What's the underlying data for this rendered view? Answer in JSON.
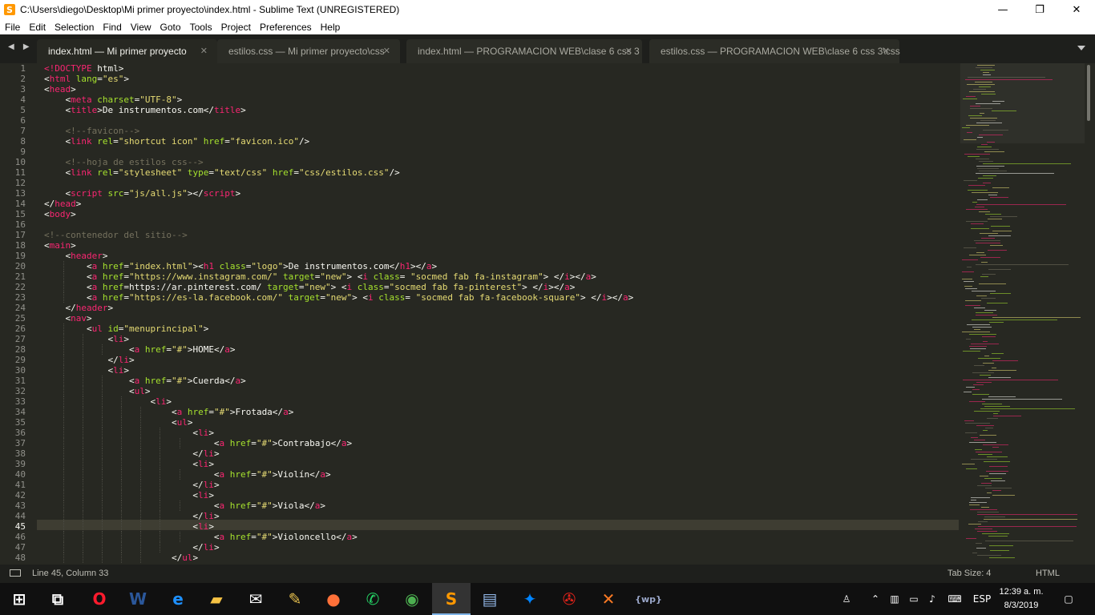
{
  "window": {
    "title": "C:\\Users\\diego\\Desktop\\Mi primer proyecto\\index.html - Sublime Text (UNREGISTERED)",
    "app_icon": "S",
    "controls": [
      "—",
      "❐",
      "✕"
    ]
  },
  "menu": [
    "File",
    "Edit",
    "Selection",
    "Find",
    "View",
    "Goto",
    "Tools",
    "Project",
    "Preferences",
    "Help"
  ],
  "tabs": [
    {
      "label": "index.html — Mi primer proyecto",
      "active": true
    },
    {
      "label": "estilos.css — Mi primer proyecto\\css",
      "active": false
    },
    {
      "label": "index.html — PROGRAMACION  WEB\\clase 6 css 3",
      "active": false
    },
    {
      "label": "estilos.css — PROGRAMACION  WEB\\clase 6 css 3\\css",
      "active": false
    }
  ],
  "tab_nav": "◀ ▶",
  "tab_close": "✕",
  "editor": {
    "current_line": 45,
    "line_numbers": [
      1,
      2,
      3,
      4,
      5,
      6,
      7,
      8,
      9,
      10,
      11,
      12,
      13,
      14,
      15,
      16,
      17,
      18,
      19,
      20,
      21,
      22,
      23,
      24,
      25,
      26,
      27,
      28,
      29,
      30,
      31,
      32,
      33,
      34,
      35,
      36,
      37,
      38,
      39,
      40,
      41,
      42,
      43,
      44,
      45,
      46,
      47,
      48
    ],
    "lines": [
      [
        [
          "t",
          "<!DOCTYPE"
        ],
        [
          "p",
          " html>"
        ]
      ],
      [
        [
          "p",
          "<"
        ],
        [
          "t",
          "html"
        ],
        [
          "a",
          " lang"
        ],
        [
          "p",
          "="
        ],
        [
          "s",
          "\"es\""
        ],
        [
          "p",
          ">"
        ]
      ],
      [
        [
          "p",
          "<"
        ],
        [
          "t",
          "head"
        ],
        [
          "p",
          ">"
        ]
      ],
      [
        [
          "p",
          "    <"
        ],
        [
          "t",
          "meta"
        ],
        [
          "a",
          " charset"
        ],
        [
          "p",
          "="
        ],
        [
          "s",
          "\"UTF-8\""
        ],
        [
          "p",
          ">"
        ]
      ],
      [
        [
          "p",
          "    <"
        ],
        [
          "t",
          "title"
        ],
        [
          "p",
          ">De instrumentos.com</"
        ],
        [
          "t",
          "title"
        ],
        [
          "p",
          ">"
        ]
      ],
      [
        [
          "p",
          ""
        ]
      ],
      [
        [
          "c",
          "    <!--favicon-->"
        ]
      ],
      [
        [
          "p",
          "    <"
        ],
        [
          "t",
          "link"
        ],
        [
          "a",
          " rel"
        ],
        [
          "p",
          "="
        ],
        [
          "s",
          "\"shortcut icon\""
        ],
        [
          "a",
          " href"
        ],
        [
          "p",
          "="
        ],
        [
          "s",
          "\"favicon.ico\""
        ],
        [
          "p",
          "/>"
        ]
      ],
      [
        [
          "p",
          ""
        ]
      ],
      [
        [
          "c",
          "    <!--hoja de estilos css-->"
        ]
      ],
      [
        [
          "p",
          "    <"
        ],
        [
          "t",
          "link"
        ],
        [
          "a",
          " rel"
        ],
        [
          "p",
          "="
        ],
        [
          "s",
          "\"stylesheet\""
        ],
        [
          "a",
          " type"
        ],
        [
          "p",
          "="
        ],
        [
          "s",
          "\"text/css\""
        ],
        [
          "a",
          " href"
        ],
        [
          "p",
          "="
        ],
        [
          "s",
          "\"css/estilos.css\""
        ],
        [
          "p",
          "/>"
        ]
      ],
      [
        [
          "p",
          ""
        ]
      ],
      [
        [
          "p",
          "    <"
        ],
        [
          "t",
          "script"
        ],
        [
          "a",
          " src"
        ],
        [
          "p",
          "="
        ],
        [
          "s",
          "\"js/all.js\""
        ],
        [
          "p",
          "></"
        ],
        [
          "t",
          "script"
        ],
        [
          "p",
          ">"
        ]
      ],
      [
        [
          "p",
          "</"
        ],
        [
          "t",
          "head"
        ],
        [
          "p",
          ">"
        ]
      ],
      [
        [
          "p",
          "<"
        ],
        [
          "t",
          "body"
        ],
        [
          "p",
          ">"
        ]
      ],
      [
        [
          "p",
          ""
        ]
      ],
      [
        [
          "c",
          "<!--contenedor del sitio-->"
        ]
      ],
      [
        [
          "p",
          "<"
        ],
        [
          "t",
          "main"
        ],
        [
          "p",
          ">"
        ]
      ],
      [
        [
          "p",
          "    <"
        ],
        [
          "t",
          "header"
        ],
        [
          "p",
          ">"
        ]
      ],
      [
        [
          "p",
          "        <"
        ],
        [
          "t",
          "a"
        ],
        [
          "a",
          " href"
        ],
        [
          "p",
          "="
        ],
        [
          "s",
          "\"index.html\""
        ],
        [
          "p",
          "><"
        ],
        [
          "t",
          "h1"
        ],
        [
          "a",
          " class"
        ],
        [
          "p",
          "="
        ],
        [
          "s",
          "\"logo\""
        ],
        [
          "p",
          ">De instrumentos.com</"
        ],
        [
          "t",
          "h1"
        ],
        [
          "p",
          "></"
        ],
        [
          "t",
          "a"
        ],
        [
          "p",
          ">"
        ]
      ],
      [
        [
          "p",
          "        <"
        ],
        [
          "t",
          "a"
        ],
        [
          "a",
          " href"
        ],
        [
          "p",
          "="
        ],
        [
          "s",
          "\"https://www.instagram.com/\""
        ],
        [
          "a",
          " target"
        ],
        [
          "p",
          "="
        ],
        [
          "s",
          "\"new\""
        ],
        [
          "p",
          "> <"
        ],
        [
          "t",
          "i"
        ],
        [
          "a",
          " class"
        ],
        [
          "p",
          "= "
        ],
        [
          "s",
          "\"socmed fab fa-instagram\""
        ],
        [
          "p",
          "> </"
        ],
        [
          "t",
          "i"
        ],
        [
          "p",
          "></"
        ],
        [
          "t",
          "a"
        ],
        [
          "p",
          ">"
        ]
      ],
      [
        [
          "p",
          "        <"
        ],
        [
          "t",
          "a"
        ],
        [
          "a",
          " href"
        ],
        [
          "p",
          "=https://ar.pinterest.com/"
        ],
        [
          "a",
          " target"
        ],
        [
          "p",
          "="
        ],
        [
          "s",
          "\"new\""
        ],
        [
          "p",
          "> <"
        ],
        [
          "t",
          "i"
        ],
        [
          "a",
          " class"
        ],
        [
          "p",
          "="
        ],
        [
          "s",
          "\"socmed fab fa-pinterest\""
        ],
        [
          "p",
          "> </"
        ],
        [
          "t",
          "i"
        ],
        [
          "p",
          "></"
        ],
        [
          "t",
          "a"
        ],
        [
          "p",
          ">"
        ]
      ],
      [
        [
          "p",
          "        <"
        ],
        [
          "t",
          "a"
        ],
        [
          "a",
          " href"
        ],
        [
          "p",
          "="
        ],
        [
          "s",
          "\"https://es-la.facebook.com/\""
        ],
        [
          "a",
          " target"
        ],
        [
          "p",
          "="
        ],
        [
          "s",
          "\"new\""
        ],
        [
          "p",
          "> <"
        ],
        [
          "t",
          "i"
        ],
        [
          "a",
          " class"
        ],
        [
          "p",
          "= "
        ],
        [
          "s",
          "\"socmed fab fa-facebook-square\""
        ],
        [
          "p",
          "> </"
        ],
        [
          "t",
          "i"
        ],
        [
          "p",
          "></"
        ],
        [
          "t",
          "a"
        ],
        [
          "p",
          ">"
        ]
      ],
      [
        [
          "p",
          "    </"
        ],
        [
          "t",
          "header"
        ],
        [
          "p",
          ">"
        ]
      ],
      [
        [
          "p",
          "    <"
        ],
        [
          "t",
          "nav"
        ],
        [
          "p",
          ">"
        ]
      ],
      [
        [
          "p",
          "        <"
        ],
        [
          "t",
          "ul"
        ],
        [
          "a",
          " id"
        ],
        [
          "p",
          "="
        ],
        [
          "s",
          "\"menuprincipal\""
        ],
        [
          "p",
          ">"
        ]
      ],
      [
        [
          "p",
          "            <"
        ],
        [
          "t",
          "li"
        ],
        [
          "p",
          ">"
        ]
      ],
      [
        [
          "p",
          "                <"
        ],
        [
          "t",
          "a"
        ],
        [
          "a",
          " href"
        ],
        [
          "p",
          "="
        ],
        [
          "s",
          "\"#\""
        ],
        [
          "p",
          ">HOME</"
        ],
        [
          "t",
          "a"
        ],
        [
          "p",
          ">"
        ]
      ],
      [
        [
          "p",
          "            </"
        ],
        [
          "t",
          "li"
        ],
        [
          "p",
          ">"
        ]
      ],
      [
        [
          "p",
          "            <"
        ],
        [
          "t",
          "li"
        ],
        [
          "p",
          ">"
        ]
      ],
      [
        [
          "p",
          "                <"
        ],
        [
          "t",
          "a"
        ],
        [
          "a",
          " href"
        ],
        [
          "p",
          "="
        ],
        [
          "s",
          "\"#\""
        ],
        [
          "p",
          ">Cuerda</"
        ],
        [
          "t",
          "a"
        ],
        [
          "p",
          ">"
        ]
      ],
      [
        [
          "p",
          "                <"
        ],
        [
          "t",
          "ul"
        ],
        [
          "p",
          ">"
        ]
      ],
      [
        [
          "p",
          "                    <"
        ],
        [
          "t",
          "li"
        ],
        [
          "p",
          ">"
        ]
      ],
      [
        [
          "p",
          "                        <"
        ],
        [
          "t",
          "a"
        ],
        [
          "a",
          " href"
        ],
        [
          "p",
          "="
        ],
        [
          "s",
          "\"#\""
        ],
        [
          "p",
          ">Frotada</"
        ],
        [
          "t",
          "a"
        ],
        [
          "p",
          ">"
        ]
      ],
      [
        [
          "p",
          "                        <"
        ],
        [
          "t",
          "ul"
        ],
        [
          "p",
          ">"
        ]
      ],
      [
        [
          "p",
          "                            <"
        ],
        [
          "t",
          "li"
        ],
        [
          "p",
          ">"
        ]
      ],
      [
        [
          "p",
          "                                <"
        ],
        [
          "t",
          "a"
        ],
        [
          "a",
          " href"
        ],
        [
          "p",
          "="
        ],
        [
          "s",
          "\"#\""
        ],
        [
          "p",
          ">Contrabajo</"
        ],
        [
          "t",
          "a"
        ],
        [
          "p",
          ">"
        ]
      ],
      [
        [
          "p",
          "                            </"
        ],
        [
          "t",
          "li"
        ],
        [
          "p",
          ">"
        ]
      ],
      [
        [
          "p",
          "                            <"
        ],
        [
          "t",
          "li"
        ],
        [
          "p",
          ">"
        ]
      ],
      [
        [
          "p",
          "                                <"
        ],
        [
          "t",
          "a"
        ],
        [
          "a",
          " href"
        ],
        [
          "p",
          "="
        ],
        [
          "s",
          "\"#\""
        ],
        [
          "p",
          ">Violín</"
        ],
        [
          "t",
          "a"
        ],
        [
          "p",
          ">"
        ]
      ],
      [
        [
          "p",
          "                            </"
        ],
        [
          "t",
          "li"
        ],
        [
          "p",
          ">"
        ]
      ],
      [
        [
          "p",
          "                            <"
        ],
        [
          "t",
          "li"
        ],
        [
          "p",
          ">"
        ]
      ],
      [
        [
          "p",
          "                                <"
        ],
        [
          "t",
          "a"
        ],
        [
          "a",
          " href"
        ],
        [
          "p",
          "="
        ],
        [
          "s",
          "\"#\""
        ],
        [
          "p",
          ">Viola</"
        ],
        [
          "t",
          "a"
        ],
        [
          "p",
          ">"
        ]
      ],
      [
        [
          "p",
          "                            </"
        ],
        [
          "t",
          "li"
        ],
        [
          "p",
          ">"
        ]
      ],
      [
        [
          "p",
          "                            <"
        ],
        [
          "t",
          "li"
        ],
        [
          "p",
          ">"
        ]
      ],
      [
        [
          "p",
          "                                <"
        ],
        [
          "t",
          "a"
        ],
        [
          "a",
          " href"
        ],
        [
          "p",
          "="
        ],
        [
          "s",
          "\"#\""
        ],
        [
          "p",
          ">Violoncello</"
        ],
        [
          "t",
          "a"
        ],
        [
          "p",
          ">"
        ]
      ],
      [
        [
          "p",
          "                            </"
        ],
        [
          "t",
          "li"
        ],
        [
          "p",
          ">"
        ]
      ],
      [
        [
          "p",
          "                        </"
        ],
        [
          "t",
          "ul"
        ],
        [
          "p",
          ">"
        ]
      ]
    ]
  },
  "status": {
    "position": "Line 45, Column 33",
    "tab_size": "Tab Size: 4",
    "syntax": "HTML"
  },
  "taskbar": {
    "apps": [
      {
        "icon": "windows-start-icon",
        "glyph": "⊞",
        "color": "#ffffff"
      },
      {
        "icon": "task-view-icon",
        "glyph": "⧉",
        "color": "#ffffff"
      },
      {
        "icon": "opera-icon",
        "glyph": "O",
        "color": "#ff1b2d"
      },
      {
        "icon": "word-icon",
        "glyph": "W",
        "color": "#2b579a"
      },
      {
        "icon": "edge-icon",
        "glyph": "e",
        "color": "#1e90ff"
      },
      {
        "icon": "file-explorer-icon",
        "glyph": "▰",
        "color": "#f6c344"
      },
      {
        "icon": "mail-icon",
        "glyph": "✉",
        "color": "#ffffff"
      },
      {
        "icon": "paint-icon",
        "glyph": "✎",
        "color": "#e8c14e"
      },
      {
        "icon": "firefox-icon",
        "glyph": "●",
        "color": "#ff7139"
      },
      {
        "icon": "whatsapp-icon",
        "glyph": "✆",
        "color": "#25d366"
      },
      {
        "icon": "chrome-icon",
        "glyph": "◉",
        "color": "#4caf50"
      },
      {
        "icon": "sublime-text-icon",
        "glyph": "S",
        "color": "#ff9800",
        "active": true
      },
      {
        "icon": "notepad-icon",
        "glyph": "▤",
        "color": "#8fb4e3"
      },
      {
        "icon": "messenger-icon",
        "glyph": "✦",
        "color": "#0084ff"
      },
      {
        "icon": "acrobat-icon",
        "glyph": "✇",
        "color": "#e2231a"
      },
      {
        "icon": "xampp-icon",
        "glyph": "✕",
        "color": "#fb7a24"
      },
      {
        "icon": "php-tool-icon",
        "glyph": "{wp}",
        "color": "#9aa7c9"
      }
    ],
    "tray": {
      "language": "ESP",
      "time": "12:39 a. m.",
      "date": "8/3/2019"
    }
  }
}
